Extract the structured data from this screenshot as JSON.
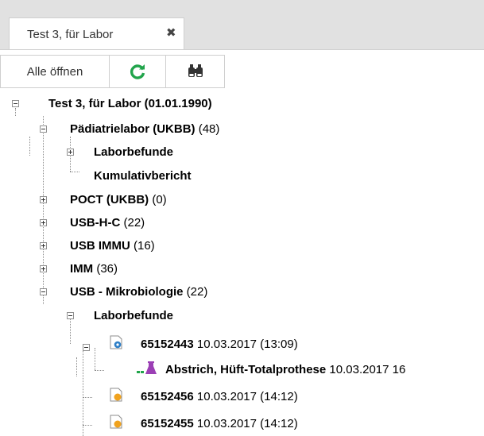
{
  "tabs": [
    {
      "label": "Test 3, für Labor",
      "close": "✖"
    }
  ],
  "toolbar": {
    "open_all": "Alle öffnen",
    "refresh_icon": "refresh-icon",
    "search_icon": "binoculars-icon",
    "accent": "#21a44b"
  },
  "tree": {
    "root": {
      "label": "Test 3, für Labor (01.01.1990)"
    },
    "nodes": [
      {
        "name": "Pädiatrielabor (UKBB)",
        "count": "(48)"
      },
      {
        "name": "Laborbefunde"
      },
      {
        "name": "Kumulativbericht"
      },
      {
        "name": "POCT (UKBB)",
        "count": "(0)"
      },
      {
        "name": "USB-H-C",
        "count": "(22)"
      },
      {
        "name": "USB IMMU",
        "count": "(16)"
      },
      {
        "name": "IMM",
        "count": "(36)"
      },
      {
        "name": "USB - Mikrobiologie",
        "count": "(22)"
      },
      {
        "name": "Laborbefunde"
      }
    ],
    "reports": [
      {
        "id": "65152443",
        "date": "10.03.2017 (13:09)",
        "status": "in-progress",
        "status_color": "#2e7fc7"
      },
      {
        "title": "Abstrich, Hüft-Totalprothese",
        "date": "10.03.2017 16"
      },
      {
        "id": "65152456",
        "date": "10.03.2017 (14:12)",
        "status": "pending",
        "status_color": "#f0a21e"
      },
      {
        "id": "65152455",
        "date": "10.03.2017 (14:12)",
        "status": "pending",
        "status_color": "#f0a21e"
      }
    ]
  }
}
